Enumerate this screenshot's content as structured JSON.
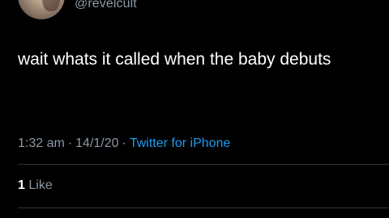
{
  "tweet": {
    "handle": "@revelcult",
    "text": "wait whats it called when the baby debuts",
    "time": "1:32 am",
    "date": "14/1/20",
    "separator": "·",
    "source": "Twitter for iPhone"
  },
  "engagement": {
    "like_count": "1",
    "like_label": "Like"
  },
  "colors": {
    "background": "#000000",
    "text": "#ffffff",
    "secondary_text": "#8b98a5",
    "link": "#1d9bf0",
    "divider": "#2f3336"
  }
}
